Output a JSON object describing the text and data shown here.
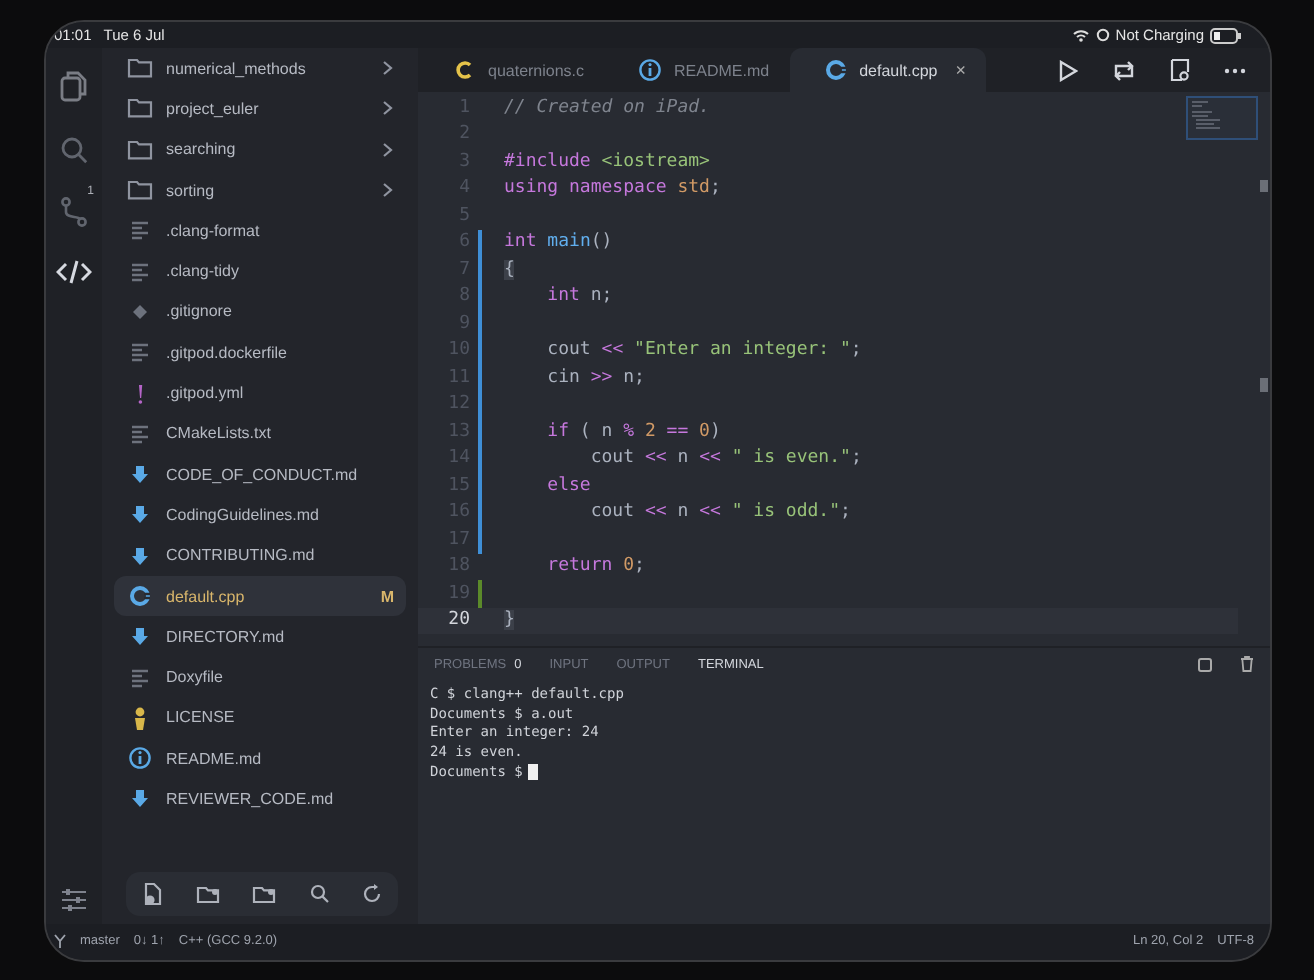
{
  "status_top": {
    "time": "01:01",
    "date": "Tue 6 Jul",
    "battery_text": "Not Charging"
  },
  "activity_bar": {
    "items": [
      {
        "kind": "files",
        "selected": false
      },
      {
        "kind": "search",
        "selected": false
      },
      {
        "kind": "source-control",
        "selected": false,
        "badge": "1"
      },
      {
        "kind": "code",
        "selected": true
      }
    ]
  },
  "explorer": {
    "items": [
      {
        "name": "numerical_methods",
        "kind": "folder",
        "selected": false
      },
      {
        "name": "project_euler",
        "kind": "folder",
        "selected": false
      },
      {
        "name": "searching",
        "kind": "folder",
        "selected": false
      },
      {
        "name": "sorting",
        "kind": "folder",
        "selected": false
      },
      {
        "name": ".clang-format",
        "kind": "lines",
        "selected": false
      },
      {
        "name": ".clang-tidy",
        "kind": "lines",
        "selected": false
      },
      {
        "name": ".gitignore",
        "kind": "diamond",
        "selected": false
      },
      {
        "name": ".gitpod.dockerfile",
        "kind": "lines",
        "selected": false
      },
      {
        "name": ".gitpod.yml",
        "kind": "yaml",
        "selected": false
      },
      {
        "name": "CMakeLists.txt",
        "kind": "lines",
        "selected": false
      },
      {
        "name": "CODE_OF_CONDUCT.md",
        "kind": "markdown",
        "selected": false
      },
      {
        "name": "CodingGuidelines.md",
        "kind": "markdown",
        "selected": false
      },
      {
        "name": "CONTRIBUTING.md",
        "kind": "markdown",
        "selected": false
      },
      {
        "name": "default.cpp",
        "kind": "cpp",
        "selected": true,
        "badge": "M"
      },
      {
        "name": "DIRECTORY.md",
        "kind": "markdown",
        "selected": false
      },
      {
        "name": "Doxyfile",
        "kind": "lines",
        "selected": false
      },
      {
        "name": "LICENSE",
        "kind": "license",
        "selected": false
      },
      {
        "name": "README.md",
        "kind": "info",
        "selected": false
      },
      {
        "name": "REVIEWER_CODE.md",
        "kind": "markdown",
        "selected": false
      }
    ]
  },
  "tabs": [
    {
      "label": "quaternions.c",
      "kind": "c",
      "selected": false
    },
    {
      "label": "README.md",
      "kind": "info",
      "selected": false
    },
    {
      "label": "default.cpp",
      "kind": "cpp",
      "selected": true,
      "close": "×"
    }
  ],
  "code_lines": [
    {
      "n": "1",
      "kind": "plain",
      "current": false,
      "tokens": [
        {
          "kind": "comment",
          "text": "// Created on iPad."
        }
      ]
    },
    {
      "n": "2",
      "kind": "plain",
      "current": false
    },
    {
      "n": "3",
      "kind": "plain",
      "current": false,
      "tokens": [
        {
          "kind": "keyword",
          "text": "#include"
        },
        {
          "kind": "string",
          "text": " <iostream>"
        }
      ]
    },
    {
      "n": "4",
      "kind": "plain",
      "current": false,
      "tokens": [
        {
          "kind": "keyword",
          "text": "using namespace"
        },
        {
          "kind": "number",
          "text": " std"
        },
        {
          "kind": "plain",
          "text": ";"
        }
      ]
    },
    {
      "n": "5",
      "kind": "plain",
      "current": false
    },
    {
      "n": "6",
      "kind": "modified",
      "current": false,
      "tokens": [
        {
          "kind": "keyword",
          "text": "int"
        },
        {
          "kind": "func",
          "text": " main"
        },
        {
          "kind": "plain",
          "text": "()"
        }
      ]
    },
    {
      "n": "7",
      "kind": "modified",
      "current": false,
      "tokens": [
        {
          "kind": "bracket",
          "text": "{"
        }
      ]
    },
    {
      "n": "8",
      "kind": "modified",
      "current": false,
      "tokens": [
        {
          "kind": "keyword",
          "text": "    int"
        },
        {
          "kind": "plain",
          "text": " n;"
        }
      ]
    },
    {
      "n": "9",
      "kind": "modified",
      "current": false
    },
    {
      "n": "10",
      "kind": "modified",
      "current": false,
      "tokens": [
        {
          "kind": "plain",
          "text": "    cout "
        },
        {
          "kind": "op",
          "text": "<<"
        },
        {
          "kind": "string",
          "text": " \"Enter an integer: \""
        },
        {
          "kind": "plain",
          "text": ";"
        }
      ]
    },
    {
      "n": "11",
      "kind": "modified",
      "current": false,
      "tokens": [
        {
          "kind": "plain",
          "text": "    cin "
        },
        {
          "kind": "op",
          "text": ">>"
        },
        {
          "kind": "plain",
          "text": " n;"
        }
      ]
    },
    {
      "n": "12",
      "kind": "modified",
      "current": false
    },
    {
      "n": "13",
      "kind": "modified",
      "current": false,
      "tokens": [
        {
          "kind": "keyword",
          "text": "    if"
        },
        {
          "kind": "plain",
          "text": " ( n "
        },
        {
          "kind": "op",
          "text": "%"
        },
        {
          "kind": "number",
          "text": " 2"
        },
        {
          "kind": "op",
          "text": " =="
        },
        {
          "kind": "number",
          "text": " 0"
        },
        {
          "kind": "plain",
          "text": ")"
        }
      ]
    },
    {
      "n": "14",
      "kind": "modified",
      "current": false,
      "tokens": [
        {
          "kind": "plain",
          "text": "        cout "
        },
        {
          "kind": "op",
          "text": "<<"
        },
        {
          "kind": "plain",
          "text": " n "
        },
        {
          "kind": "op",
          "text": "<<"
        },
        {
          "kind": "string",
          "text": " \" is even.\""
        },
        {
          "kind": "plain",
          "text": ";"
        }
      ]
    },
    {
      "n": "15",
      "kind": "modified",
      "current": false,
      "tokens": [
        {
          "kind": "keyword",
          "text": "    else"
        }
      ]
    },
    {
      "n": "16",
      "kind": "modified",
      "current": false,
      "tokens": [
        {
          "kind": "plain",
          "text": "        cout "
        },
        {
          "kind": "op",
          "text": "<<"
        },
        {
          "kind": "plain",
          "text": " n "
        },
        {
          "kind": "op",
          "text": "<<"
        },
        {
          "kind": "string",
          "text": " \" is odd.\""
        },
        {
          "kind": "plain",
          "text": ";"
        }
      ]
    },
    {
      "n": "17",
      "kind": "modified",
      "current": false
    },
    {
      "n": "18",
      "kind": "plain",
      "current": false,
      "tokens": [
        {
          "kind": "keyword",
          "text": "    return"
        },
        {
          "kind": "number",
          "text": " 0"
        },
        {
          "kind": "plain",
          "text": ";"
        }
      ]
    },
    {
      "n": "19",
      "kind": "added",
      "current": false
    },
    {
      "n": "20",
      "kind": "plain",
      "current": true,
      "tokens": [
        {
          "kind": "bracket",
          "text": "}"
        }
      ]
    }
  ],
  "panel": {
    "tabs": [
      {
        "label": "PROBLEMS",
        "selected": false,
        "badge": "0"
      },
      {
        "label": "INPUT",
        "selected": false
      },
      {
        "label": "OUTPUT",
        "selected": false
      },
      {
        "label": "TERMINAL",
        "selected": true
      }
    ],
    "terminal": [
      "C $ clang++ default.cpp",
      "Documents $ a.out",
      "Enter an integer: 24",
      "24 is even.",
      "Documents $"
    ]
  },
  "status_bar": {
    "branch": "master",
    "sync": "0↓ 1↑",
    "language": "C++ (GCC 9.2.0)",
    "position": "Ln 20, Col 2",
    "encoding": "UTF-8"
  }
}
